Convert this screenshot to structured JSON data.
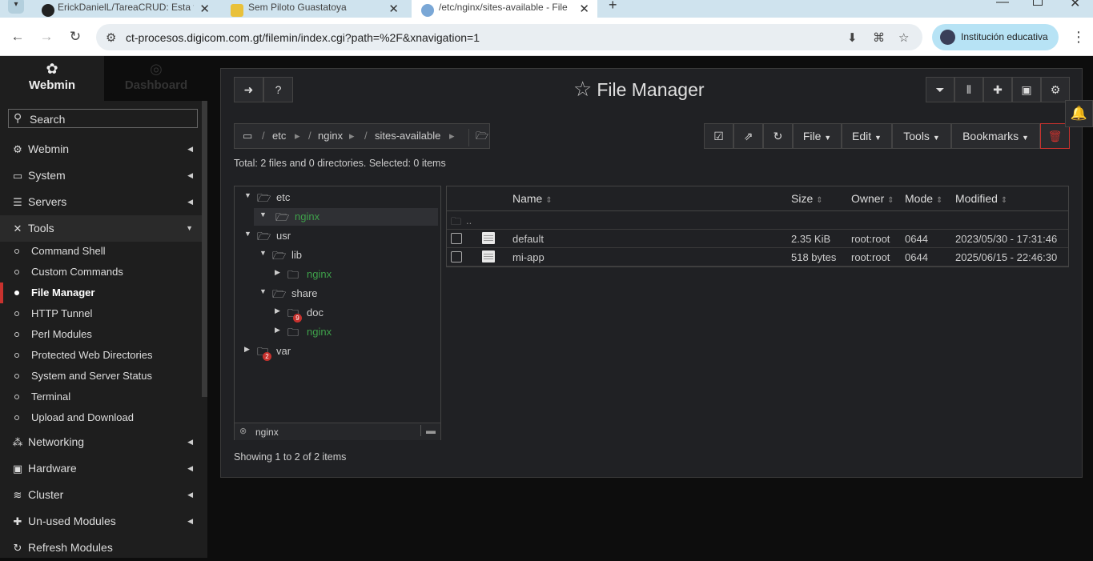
{
  "browser": {
    "tabs": [
      {
        "label": "ErickDanielL/TareaCRUD: Esta ta"
      },
      {
        "label": "Sem Piloto Guastatoya"
      },
      {
        "label": "/etc/nginx/sites-available - File"
      }
    ],
    "url": "ct-procesos.digicom.com.gt/filemin/index.cgi?path=%2F&xnavigation=1",
    "profile_label": "Institución educativa"
  },
  "sidebar": {
    "tab_webmin": "Webmin",
    "tab_dashboard": "Dashboard",
    "search_placeholder": "Search",
    "categories": [
      {
        "label": "Webmin",
        "icon": "gear-icon"
      },
      {
        "label": "System",
        "icon": "monitor-icon"
      },
      {
        "label": "Servers",
        "icon": "server-icon"
      },
      {
        "label": "Tools",
        "icon": "tools-icon"
      },
      {
        "label": "Networking",
        "icon": "network-icon"
      },
      {
        "label": "Hardware",
        "icon": "hardware-icon"
      },
      {
        "label": "Cluster",
        "icon": "cluster-icon"
      },
      {
        "label": "Un-used Modules",
        "icon": "puzzle-icon"
      },
      {
        "label": "Refresh Modules",
        "icon": "refresh-icon"
      }
    ],
    "tools_items": [
      "Command Shell",
      "Custom Commands",
      "File Manager",
      "HTTP Tunnel",
      "Perl Modules",
      "Protected Web Directories",
      "System and Server Status",
      "Terminal",
      "Upload and Download"
    ],
    "active_item": "File Manager"
  },
  "panel": {
    "title": "File Manager",
    "breadcrumb": [
      "etc",
      "nginx",
      "sites-available"
    ],
    "menus": {
      "file": "File",
      "edit": "Edit",
      "tools": "Tools",
      "bookmarks": "Bookmarks"
    },
    "summary": "Total: 2 files and 0 directories. Selected: 0 items",
    "tree": [
      {
        "label": "etc"
      },
      {
        "label": "nginx"
      },
      {
        "label": "usr"
      },
      {
        "label": "lib"
      },
      {
        "label": "nginx"
      },
      {
        "label": "share"
      },
      {
        "label": "doc",
        "badge": "9"
      },
      {
        "label": "nginx"
      },
      {
        "label": "var",
        "badge": "2"
      }
    ],
    "tree_filter": "nginx",
    "table": {
      "headers": {
        "name": "Name",
        "size": "Size",
        "owner": "Owner",
        "mode": "Mode",
        "modified": "Modified"
      },
      "parent": "..",
      "rows": [
        {
          "name": "default",
          "size": "2.35 KiB",
          "owner": "root:root",
          "mode": "0644",
          "modified": "2023/05/30 - 17:31:46"
        },
        {
          "name": "mi-app",
          "size": "518 bytes",
          "owner": "root:root",
          "mode": "0644",
          "modified": "2025/06/15 - 22:46:30"
        }
      ]
    },
    "showing": "Showing 1 to 2 of 2 items"
  },
  "colors": {
    "accent": "#c8322e",
    "green_folder": "#3ea04a",
    "panel_bg": "#202124"
  }
}
